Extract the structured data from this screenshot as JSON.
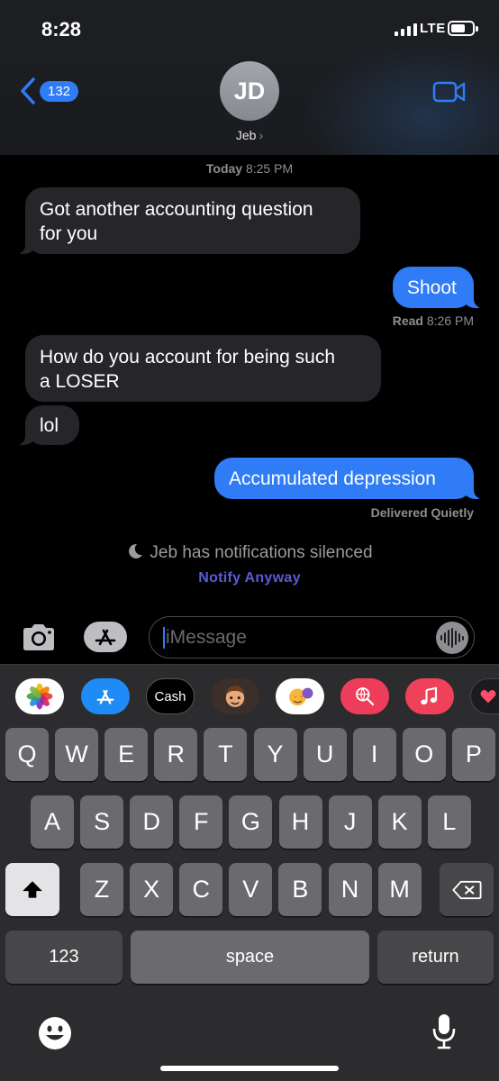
{
  "status_bar": {
    "time": "8:28",
    "network": "LTE",
    "battery_level": 0.55
  },
  "header": {
    "back_count": "132",
    "avatar_initials": "JD",
    "contact_name": "Jeb",
    "chevron": "›",
    "icons": {
      "back": "chevron-left-icon",
      "video": "video-camera-icon"
    },
    "accent_color": "#2f7cf6"
  },
  "conversation": {
    "timestamp_day": "Today",
    "timestamp_time": "8:25 PM",
    "messages": [
      {
        "from": "Jeb",
        "text_line1": "Got another accounting question",
        "text_line2": "for you"
      },
      {
        "from": "me",
        "text": "Shoot"
      },
      {
        "from": "Jeb",
        "text_line1": "How do you account for being such",
        "text_line2": "a LOSER"
      },
      {
        "from": "Jeb",
        "text": "lol"
      },
      {
        "from": "me",
        "text": "Accumulated depression"
      }
    ],
    "read_label": "Read",
    "read_time": "8:26 PM",
    "delivered_label": "Delivered Quietly",
    "silenced_text": "Jeb has notifications silenced",
    "notify_anyway": "Notify Anyway"
  },
  "input_bar": {
    "placeholder": "iMessage",
    "icons": {
      "camera": "camera-icon",
      "apps": "app-store-icon",
      "audio": "waveform-icon"
    }
  },
  "apps_row": {
    "items": [
      {
        "name": "photos-app-icon"
      },
      {
        "name": "app-store-icon"
      },
      {
        "name": "apple-cash-icon",
        "label": "Cash"
      },
      {
        "name": "memoji-icon"
      },
      {
        "name": "memoji-stickers-icon"
      },
      {
        "name": "web-search-icon"
      },
      {
        "name": "music-icon"
      },
      {
        "name": "digital-touch-icon"
      }
    ]
  },
  "keyboard": {
    "row1": [
      "Q",
      "W",
      "E",
      "R",
      "T",
      "Y",
      "U",
      "I",
      "O",
      "P"
    ],
    "row2": [
      "A",
      "S",
      "D",
      "F",
      "G",
      "H",
      "J",
      "K",
      "L"
    ],
    "row3": [
      "Z",
      "X",
      "C",
      "V",
      "B",
      "N",
      "M"
    ],
    "numbers_key": "123",
    "space_key": "space",
    "return_key": "return",
    "icons": {
      "shift": "shift-icon",
      "delete": "backspace-icon",
      "emoji": "emoji-icon",
      "dictation": "microphone-icon"
    }
  }
}
